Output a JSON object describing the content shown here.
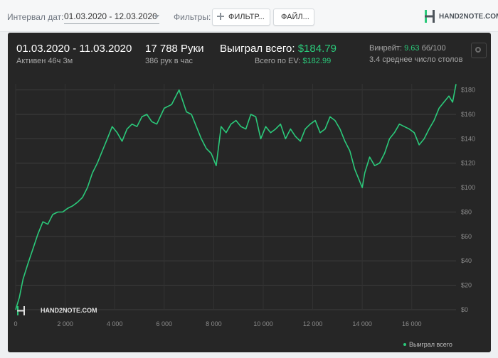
{
  "topbar": {
    "date_label": "Интервал дат:",
    "date_value": "01.03.2020 - 12.03.2020",
    "filters_label": "Фильтры:",
    "filter_button": "ФИЛЬТР...",
    "file_button": "ФАЙЛ...",
    "logo_text": "HAND2NOTE.COM"
  },
  "stats": {
    "date_range": "01.03.2020 - 11.03.2020",
    "active": "Активен 46ч 3м",
    "hands": "17 788 Руки",
    "hands_per_hour": "386 рук в час",
    "won_label": "Выиграл всего:",
    "won_value": "$184.79",
    "ev_label": "Всего по EV:",
    "ev_value": "$182.99",
    "winrate_label": "Винрейт:",
    "winrate_value": "9.63",
    "winrate_extra": "бб/100",
    "avg_tables": "3.4 среднее число столов"
  },
  "colors": {
    "line": "#2bc97a",
    "accent": "#2bc97a",
    "panel_bg": "#262626"
  },
  "watermark": "HAND2NOTE.COM",
  "chart_data": {
    "type": "line",
    "xlim": [
      0,
      17788
    ],
    "ylim": [
      0,
      185
    ],
    "x_ticks": [
      0,
      2000,
      4000,
      6000,
      8000,
      10000,
      12000,
      14000,
      16000
    ],
    "x_tick_labels": [
      "0",
      "2 000",
      "4 000",
      "6 000",
      "8 000",
      "10 000",
      "12 000",
      "14 000",
      "16 000"
    ],
    "y_ticks": [
      0,
      20,
      40,
      60,
      80,
      100,
      120,
      140,
      160,
      180
    ],
    "y_tick_labels": [
      "$0",
      "$20",
      "$40",
      "$60",
      "$80",
      "$100",
      "$120",
      "$140",
      "$160",
      "$180"
    ],
    "legend_position": "bottom-right",
    "grid": true,
    "series": [
      {
        "name": "Выиграл всего",
        "x": [
          0,
          150,
          300,
          500,
          700,
          900,
          1100,
          1300,
          1500,
          1700,
          1900,
          2100,
          2300,
          2500,
          2700,
          2900,
          3100,
          3300,
          3500,
          3700,
          3900,
          4100,
          4300,
          4500,
          4700,
          4900,
          5100,
          5300,
          5500,
          5700,
          6000,
          6300,
          6600,
          6900,
          7100,
          7300,
          7500,
          7700,
          7900,
          8100,
          8300,
          8500,
          8700,
          8900,
          9100,
          9300,
          9500,
          9700,
          9900,
          10100,
          10300,
          10500,
          10700,
          10900,
          11100,
          11300,
          11500,
          11700,
          11900,
          12100,
          12300,
          12500,
          12700,
          12900,
          13100,
          13300,
          13500,
          13700,
          13900,
          14000,
          14100,
          14300,
          14500,
          14700,
          14900,
          15100,
          15300,
          15500,
          15700,
          15900,
          16100,
          16300,
          16500,
          16700,
          16900,
          17100,
          17300,
          17500,
          17650,
          17788
        ],
        "y": [
          0,
          10,
          25,
          38,
          50,
          62,
          72,
          70,
          78,
          80,
          80,
          83,
          85,
          88,
          92,
          100,
          112,
          120,
          130,
          140,
          150,
          145,
          138,
          148,
          152,
          150,
          158,
          160,
          154,
          152,
          165,
          168,
          180,
          162,
          160,
          150,
          140,
          132,
          128,
          118,
          150,
          145,
          152,
          155,
          150,
          148,
          160,
          158,
          140,
          150,
          145,
          148,
          152,
          140,
          148,
          142,
          138,
          148,
          152,
          155,
          145,
          148,
          158,
          155,
          148,
          138,
          130,
          115,
          105,
          100,
          112,
          125,
          118,
          120,
          128,
          140,
          145,
          152,
          150,
          148,
          145,
          135,
          140,
          148,
          155,
          165,
          170,
          175,
          170,
          184.79
        ]
      }
    ]
  }
}
